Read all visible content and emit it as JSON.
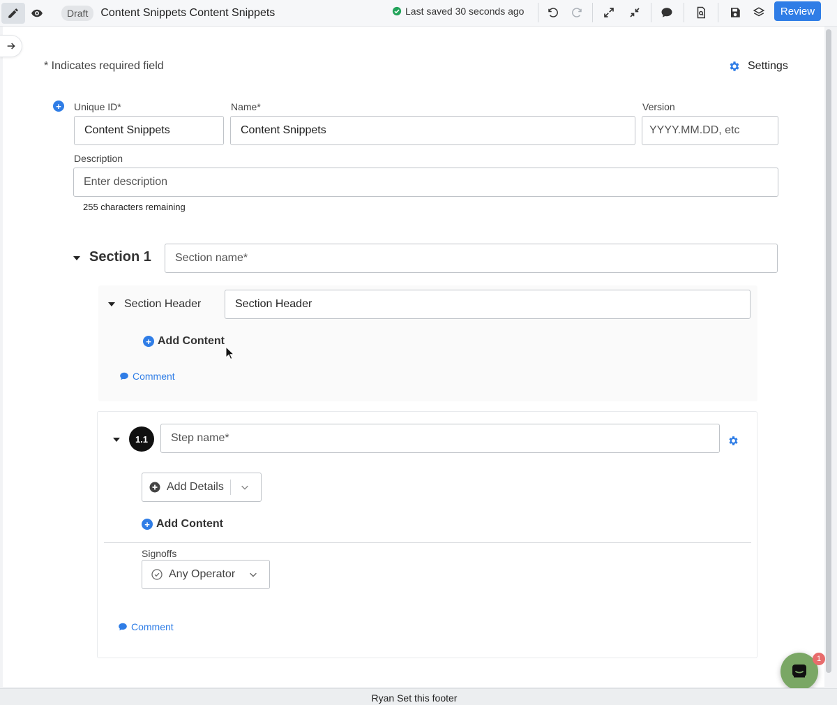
{
  "toolbar": {
    "status_badge": "Draft",
    "document_title": "Content Snippets Content Snippets",
    "saved_text": "Last saved 30 seconds ago",
    "review_label": "Review",
    "icons": [
      "pencil-icon",
      "eye-icon",
      "undo-icon",
      "redo-icon",
      "expand-icon",
      "collapse-icon",
      "comment-icon",
      "document-search-icon",
      "save-icon",
      "layers-icon"
    ]
  },
  "form": {
    "required_note": "* Indicates required field",
    "settings_label": "Settings",
    "unique_id": {
      "label": "Unique ID*",
      "value": "Content Snippets"
    },
    "name": {
      "label": "Name*",
      "value": "Content Snippets"
    },
    "version": {
      "label": "Version",
      "placeholder": "YYYY.MM.DD, etc"
    },
    "description": {
      "label": "Description",
      "placeholder": "Enter description",
      "remaining": "255 characters remaining"
    }
  },
  "section": {
    "title": "Section 1",
    "name_placeholder": "Section name*",
    "header_block": {
      "label": "Section Header",
      "value": "Section Header",
      "add_content": "Add Content",
      "comment": "Comment"
    },
    "step": {
      "number": "1.1",
      "name_placeholder": "Step name*",
      "add_details": "Add Details",
      "add_content": "Add Content",
      "signoffs_label": "Signoffs",
      "signoff_value": "Any Operator",
      "comment": "Comment"
    }
  },
  "chat": {
    "unread_count": "1"
  },
  "footer": {
    "text": "Ryan Set this footer"
  },
  "colors": {
    "accent": "#2f7de6",
    "success": "#22a35a",
    "chat": "#7aa765",
    "badge": "#e86c6c"
  }
}
